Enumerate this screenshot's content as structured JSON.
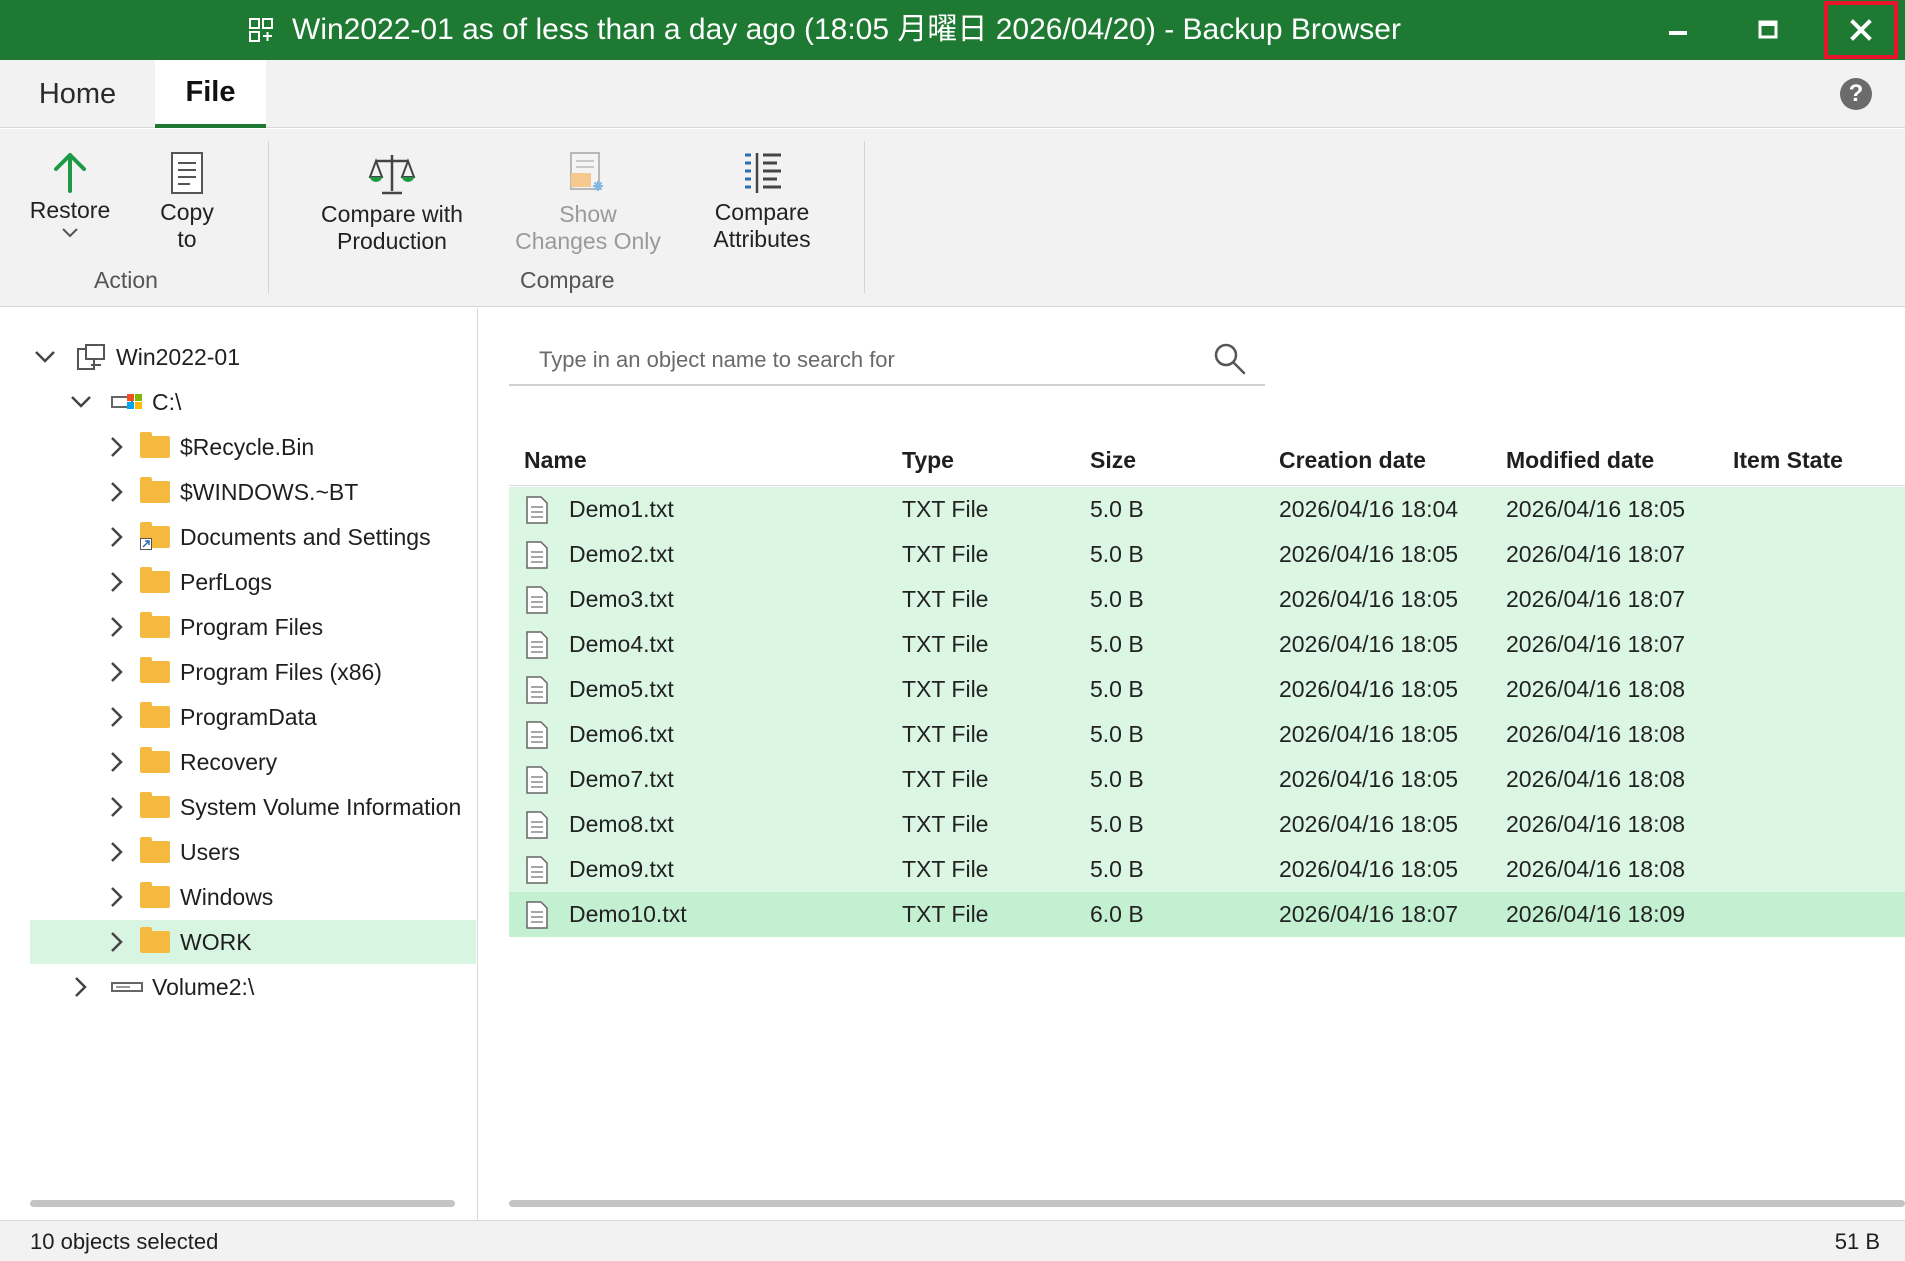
{
  "window": {
    "title": "Win2022-01 as of less than a day ago (18:05 月曜日 2026/04/20) - Backup Browser",
    "minimize_glyph": "–",
    "accent_color": "#1e7a32",
    "close_highlight_color": "#e8142b"
  },
  "tabs": [
    {
      "label": "Home",
      "active": false
    },
    {
      "label": "File",
      "active": true
    }
  ],
  "help_glyph": "?",
  "ribbon": {
    "restore": {
      "label1": "Restore",
      "icon": "arrow-up-icon"
    },
    "copy_to": {
      "label1": "Copy",
      "label2": "to",
      "icon": "document-icon"
    },
    "action_group": "Action",
    "compare_with_production": {
      "label1": "Compare with",
      "label2": "Production",
      "icon": "scales-icon"
    },
    "show_changes_only": {
      "label1": "Show",
      "label2": "Changes Only",
      "icon": "changes-icon",
      "disabled": true
    },
    "compare_attributes": {
      "label1": "Compare",
      "label2": "Attributes",
      "icon": "attributes-icon"
    },
    "compare_group": "Compare"
  },
  "tree": {
    "root": "Win2022-01",
    "drive_c": "C:\\",
    "folders": [
      "$Recycle.Bin",
      "$WINDOWS.~BT",
      "Documents and Settings",
      "PerfLogs",
      "Program Files",
      "Program Files (x86)",
      "ProgramData",
      "Recovery",
      "System Volume Information",
      "Users",
      "Windows",
      "WORK"
    ],
    "selected": "WORK",
    "volume2": "Volume2:\\"
  },
  "search": {
    "placeholder": "Type in an object name to search for",
    "value": ""
  },
  "table": {
    "columns": [
      "Name",
      "Type",
      "Size",
      "Creation date",
      "Modified date",
      "Item State"
    ],
    "rows": [
      {
        "name": "Demo1.txt",
        "type": "TXT File",
        "size": "5.0 B",
        "created": "2026/04/16 18:04",
        "modified": "2026/04/16 18:05",
        "state": ""
      },
      {
        "name": "Demo2.txt",
        "type": "TXT File",
        "size": "5.0 B",
        "created": "2026/04/16 18:05",
        "modified": "2026/04/16 18:07",
        "state": ""
      },
      {
        "name": "Demo3.txt",
        "type": "TXT File",
        "size": "5.0 B",
        "created": "2026/04/16 18:05",
        "modified": "2026/04/16 18:07",
        "state": ""
      },
      {
        "name": "Demo4.txt",
        "type": "TXT File",
        "size": "5.0 B",
        "created": "2026/04/16 18:05",
        "modified": "2026/04/16 18:07",
        "state": ""
      },
      {
        "name": "Demo5.txt",
        "type": "TXT File",
        "size": "5.0 B",
        "created": "2026/04/16 18:05",
        "modified": "2026/04/16 18:08",
        "state": ""
      },
      {
        "name": "Demo6.txt",
        "type": "TXT File",
        "size": "5.0 B",
        "created": "2026/04/16 18:05",
        "modified": "2026/04/16 18:08",
        "state": ""
      },
      {
        "name": "Demo7.txt",
        "type": "TXT File",
        "size": "5.0 B",
        "created": "2026/04/16 18:05",
        "modified": "2026/04/16 18:08",
        "state": ""
      },
      {
        "name": "Demo8.txt",
        "type": "TXT File",
        "size": "5.0 B",
        "created": "2026/04/16 18:05",
        "modified": "2026/04/16 18:08",
        "state": ""
      },
      {
        "name": "Demo9.txt",
        "type": "TXT File",
        "size": "5.0 B",
        "created": "2026/04/16 18:05",
        "modified": "2026/04/16 18:08",
        "state": ""
      },
      {
        "name": "Demo10.txt",
        "type": "TXT File",
        "size": "6.0 B",
        "created": "2026/04/16 18:07",
        "modified": "2026/04/16 18:09",
        "state": ""
      }
    ],
    "selection_color": "#dbf7e4"
  },
  "status": {
    "selected_text": "10 objects selected",
    "total_size": "51 B"
  }
}
